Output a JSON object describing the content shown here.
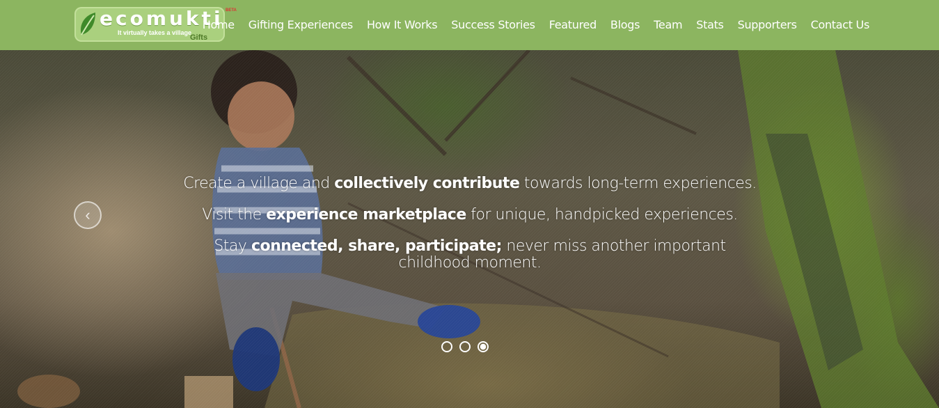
{
  "brand": {
    "name": "ecomukti",
    "tagline": "It virtually takes a village",
    "sub": "Gifts",
    "badge": "BETA"
  },
  "nav": {
    "items": [
      {
        "label": "Home"
      },
      {
        "label": "Gifting Experiences"
      },
      {
        "label": "How It Works"
      },
      {
        "label": "Success Stories"
      },
      {
        "label": "Featured"
      },
      {
        "label": "Blogs"
      },
      {
        "label": "Team"
      },
      {
        "label": "Stats"
      },
      {
        "label": "Supporters"
      },
      {
        "label": "Contact Us"
      }
    ]
  },
  "hero": {
    "lines": [
      {
        "pre": "Create a village and ",
        "bold": "collectively contribute",
        "post": " towards long-term experiences."
      },
      {
        "pre": "Visit the ",
        "bold": "experience marketplace",
        "post": " for unique, handpicked experiences."
      },
      {
        "pre": "Stay ",
        "bold": "connected, share, participate;",
        "post": " never miss another important childhood moment."
      }
    ],
    "prev_icon": "chevron-left-icon",
    "slides": {
      "count": 3,
      "active_index": 2
    }
  },
  "colors": {
    "navbar": "#8cb560",
    "logo_bg": "#aad07e",
    "nav_text": "#ffffff"
  }
}
